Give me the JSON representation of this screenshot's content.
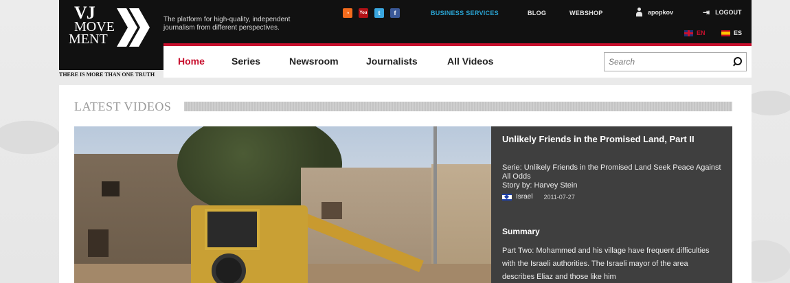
{
  "brand": {
    "logo_line1": "VJ",
    "logo_line2": "MOVE",
    "logo_line3": "MENT",
    "tagline": "THERE IS MORE THAN ONE TRUTH",
    "platform_text": "The platform for high-quality, independent journalism from different perspectives."
  },
  "social": [
    {
      "icon": "rss-icon",
      "glyph": "◔"
    },
    {
      "icon": "youtube-icon",
      "glyph": "You"
    },
    {
      "icon": "twitter-icon",
      "glyph": "t"
    },
    {
      "icon": "facebook-icon",
      "glyph": "f"
    }
  ],
  "toplinks": {
    "business": "BUSINESS SERVICES",
    "blog": "BLOG",
    "webshop": "WEBSHOP"
  },
  "user": {
    "name": "apopkov",
    "logout": "LOGOUT"
  },
  "languages": {
    "en": "EN",
    "es": "ES"
  },
  "nav": {
    "home": "Home",
    "series": "Series",
    "newsroom": "Newsroom",
    "journalists": "Journalists",
    "all_videos": "All Videos"
  },
  "search": {
    "placeholder": "Search"
  },
  "latest": {
    "heading": "LATEST VIDEOS"
  },
  "video": {
    "title": "Unlikely Friends in the Promised Land, Part II",
    "serie": "Serie: Unlikely Friends in the Promised Land Seek Peace Against All Odds",
    "story_by": "Story by: Harvey Stein",
    "country": "Israel",
    "date": "2011-07-27",
    "summary_heading": "Summary",
    "summary": "Part Two: Mohammed and his village have frequent difficulties with the Israeli authorities. The Israeli mayor of the area describes Eliaz and those like him"
  },
  "colors": {
    "accent_red": "#c8102e",
    "business_blue": "#2aa6d6",
    "topbar": "#111111",
    "info_bg": "#3f3f3f"
  }
}
